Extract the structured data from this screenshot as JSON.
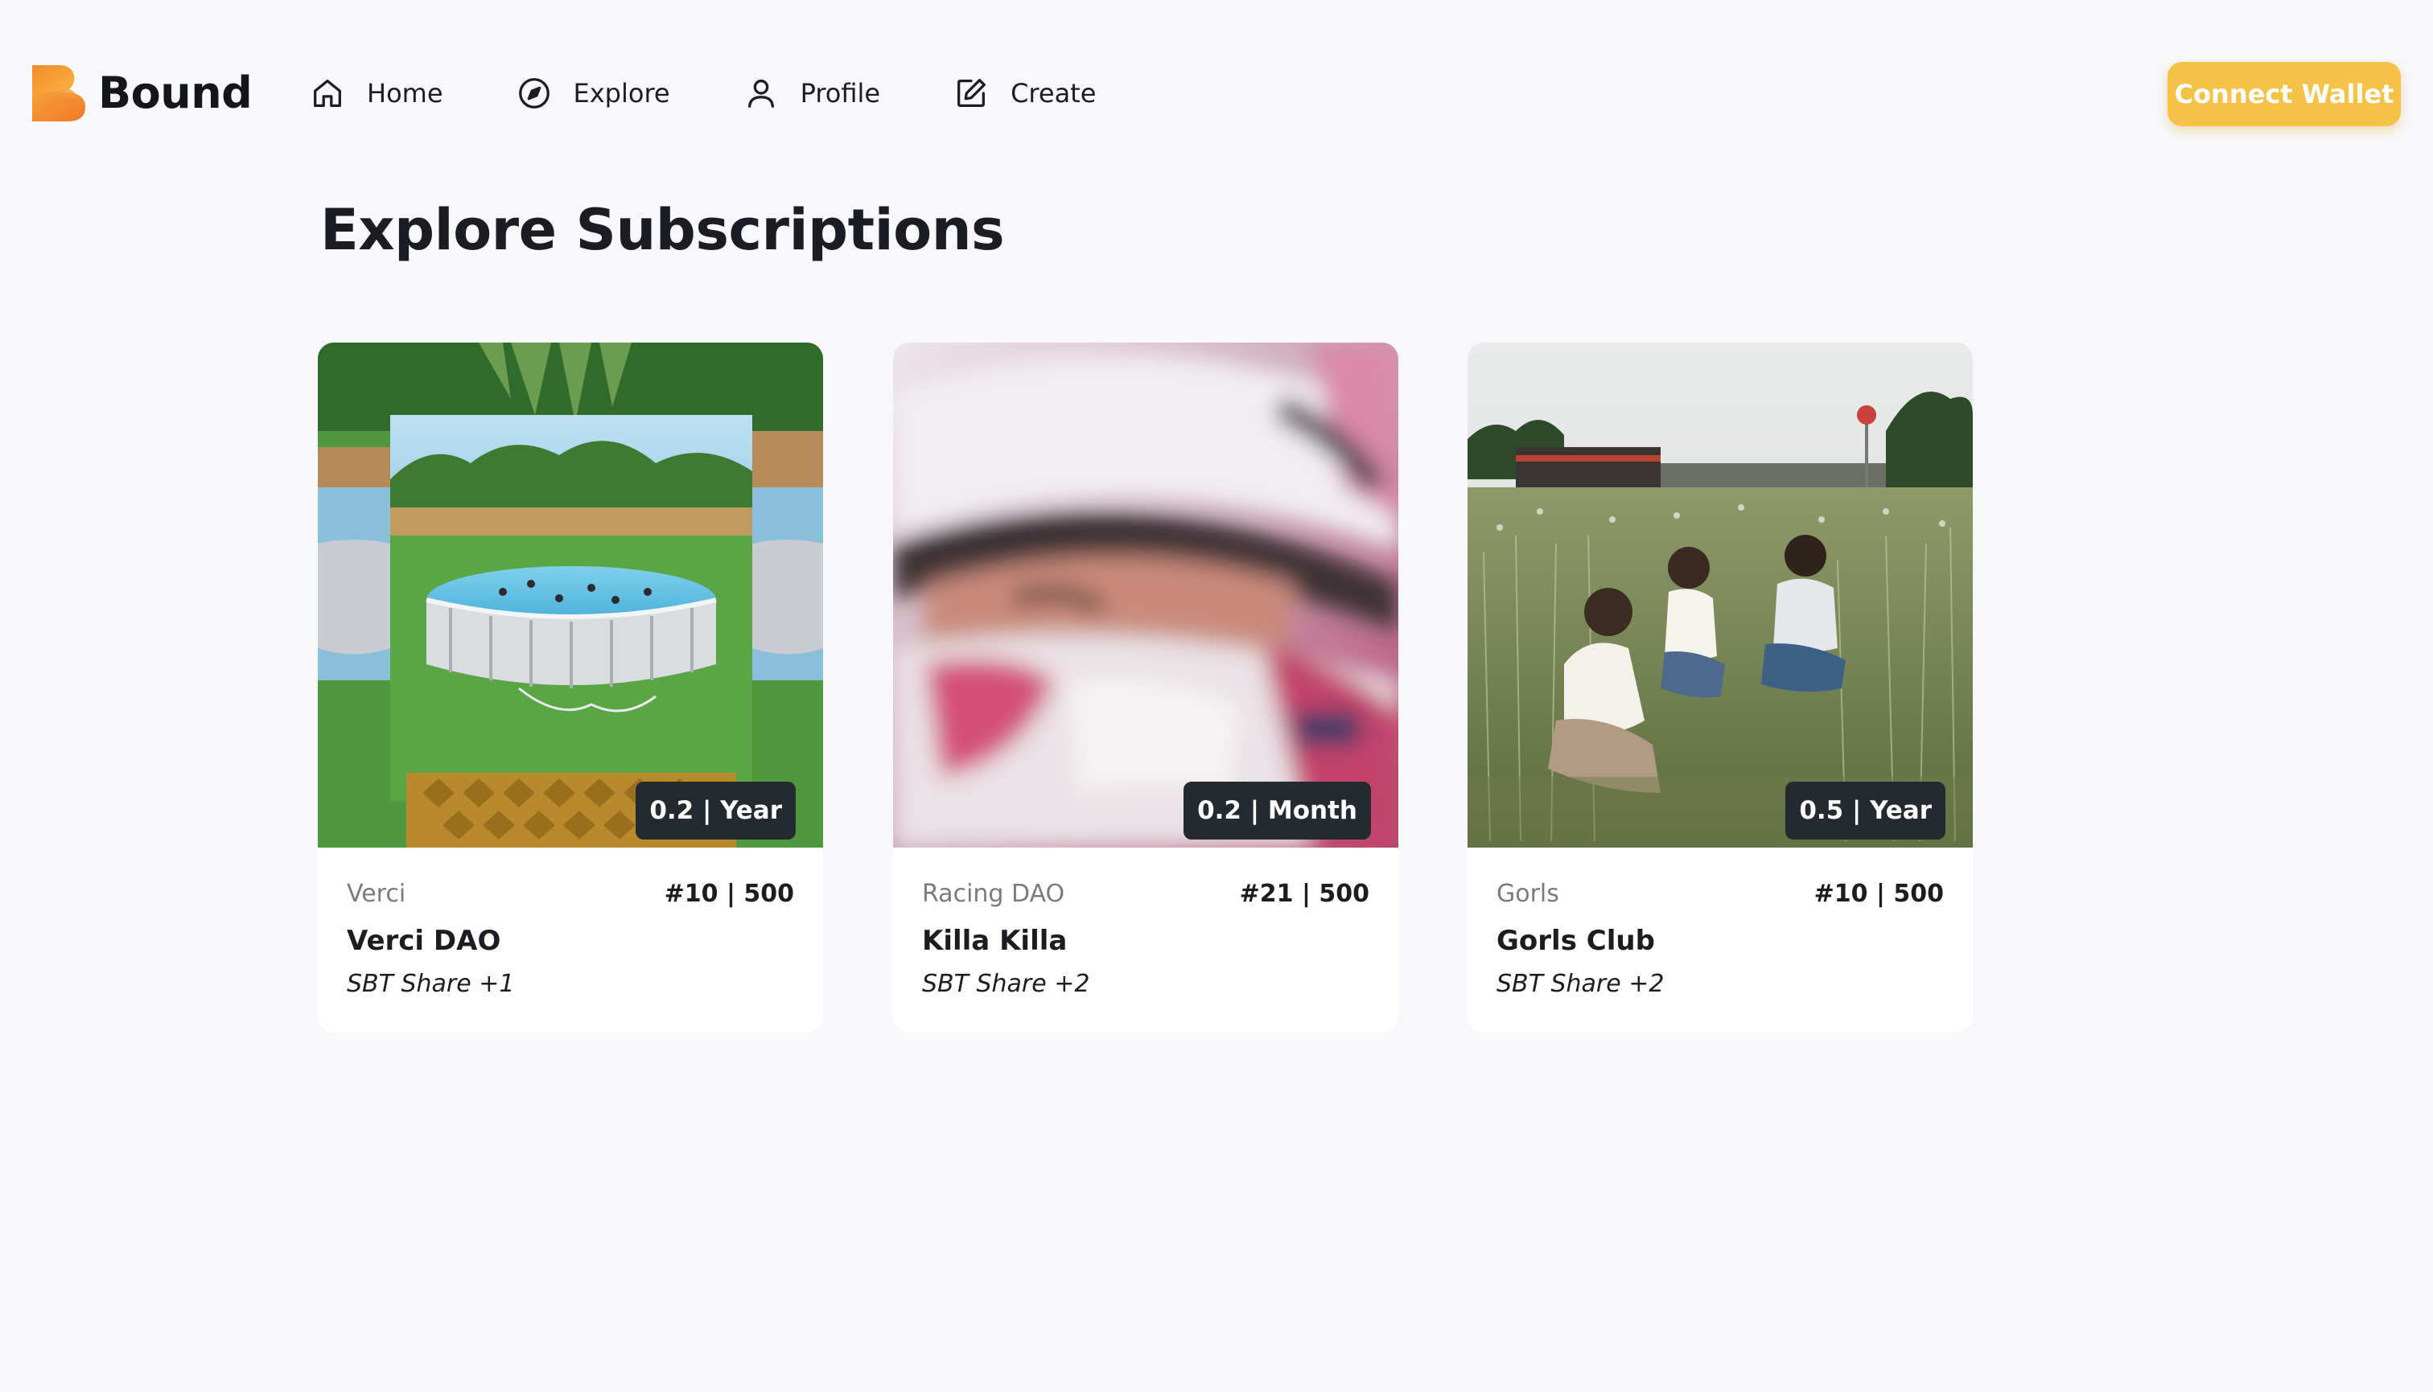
{
  "brand": {
    "name": "Bound",
    "colors": {
      "logo_top": "#f59a3c",
      "logo_bottom": "#f6b13e",
      "accent": "#f4c247"
    }
  },
  "nav": {
    "items": [
      {
        "label": "Home",
        "icon": "home-icon"
      },
      {
        "label": "Explore",
        "icon": "compass-icon"
      },
      {
        "label": "Profile",
        "icon": "user-icon"
      },
      {
        "label": "Create",
        "icon": "edit-icon"
      }
    ]
  },
  "header": {
    "connect_label": "Connect Wallet"
  },
  "main": {
    "title": "Explore Subscriptions"
  },
  "cards": [
    {
      "org": "Verci",
      "supply": "#10 | 500",
      "name": "Verci DAO",
      "share": "SBT Share +1",
      "price": "0.2 | Year",
      "image": "collage of above-ground swimming pools on grass with pineapple"
    },
    {
      "org": "Racing DAO",
      "supply": "#21 | 500",
      "name": "Killa Killa",
      "share": "SBT Share +2",
      "price": "0.2 | Month",
      "image": "motion-blurred racing helmet close-up"
    },
    {
      "org": "Gorls",
      "supply": "#10 | 500",
      "name": "Gorls Club",
      "share": "SBT Share +2",
      "price": "0.5 | Year",
      "image": "three girls eating ice cream in a tall grass field"
    }
  ],
  "colors": {
    "price_badge": "#242a30",
    "background": "#f8f8fa"
  }
}
